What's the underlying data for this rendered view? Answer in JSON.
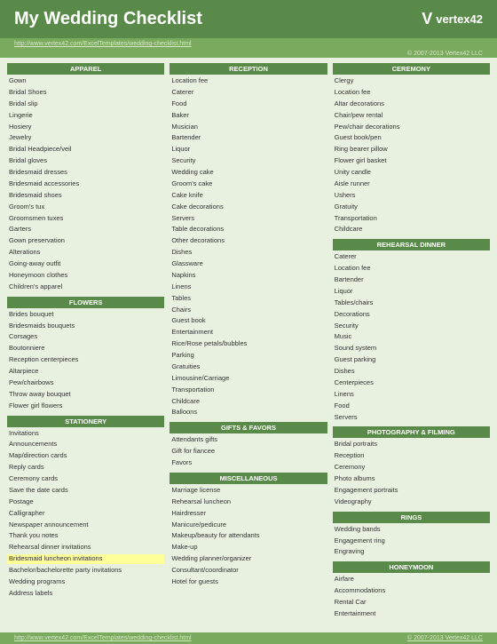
{
  "header": {
    "title": "My Wedding Checklist",
    "logo": "vertex42"
  },
  "urls": {
    "top": "http://www.vertex42.com/ExcelTemplates/wedding-checklist.html",
    "bottom": "http://www.vertex42.com/ExcelTemplates/wedding-checklist.html"
  },
  "copyright": "© 2007-2013 Vertex42 LLC",
  "columns": [
    {
      "sections": [
        {
          "header": "APPAREL",
          "items": [
            "Gown",
            "Bridal Shoes",
            "Bridal slip",
            "Lingerie",
            "Hosiery",
            "Jewelry",
            "Bridal Headpiece/veil",
            "Bridal gloves",
            "Bridesmaid dresses",
            "Bridesmaid accessories",
            "Bridesmaid shoes",
            "Groom's tux",
            "Groomsmen tuxes",
            "Garters",
            "Gown preservation",
            "Alterations",
            "Going-away outfit",
            "Honeymoon clothes",
            "Children's apparel"
          ]
        },
        {
          "header": "FLOWERS",
          "items": [
            "Brides bouquet",
            "Bridesmaids bouquets",
            "Corsages",
            "Boutonniere",
            "Reception centerpieces",
            "Altarpiece",
            "Pew/chairbows",
            "Throw away bouquet",
            "Flower girl flowers"
          ]
        },
        {
          "header": "STATIONERY",
          "items": [
            "Invitations",
            "Announcements",
            "Map/direction cards",
            "Reply cards",
            "Ceremony cards",
            "Save the date cards",
            "Postage",
            "Calligrapher",
            "Newspaper announcement",
            "Thank you notes",
            "Rehearsal dinner invitations",
            "Bridesmaid luncheon invitations",
            "Bachelor/bachelorette party invitations",
            "Wedding programs",
            "Address labels"
          ]
        }
      ]
    },
    {
      "sections": [
        {
          "header": "RECEPTION",
          "items": [
            "Location fee",
            "Caterer",
            "Food",
            "Baker",
            "Musician",
            "Bartender",
            "Liquor",
            "Security",
            "Wedding cake",
            "Groom's cake",
            "Cake knife",
            "Cake decorations",
            "Servers",
            "Table decorations",
            "Other decorations",
            "Dishes",
            "Glassware",
            "Napkins",
            "Linens",
            "Tables",
            "Chairs",
            "Guest book",
            "Entertainment",
            "Rice/Rose petals/bubbles",
            "Parking",
            "Gratuities",
            "Limousine/Carriage",
            "Transportation",
            "Childcare",
            "Balloons"
          ]
        },
        {
          "header": "GIFTS & FAVORS",
          "items": [
            "Attendants gifts",
            "Gift for fiancee",
            "Favors"
          ]
        },
        {
          "header": "MISCELLANEOUS",
          "items": [
            "Marriage license",
            "Rehearsal luncheon",
            "Hairdresser",
            "Manicure/pedicure",
            "Makeup/beauty for attendants",
            "Make-up",
            "Wedding planner/organizer",
            "Consultant/coordinator",
            "Hotel for guests"
          ]
        }
      ]
    },
    {
      "sections": [
        {
          "header": "CEREMONY",
          "items": [
            "Clergy",
            "Location fee",
            "Altar decorations",
            "Chair/pew rental",
            "Pew/chair decorations",
            "Guest book/pen",
            "Ring bearer pillow",
            "Flower girl basket",
            "Unity candle",
            "Aisle runner",
            "Ushers",
            "Gratuity",
            "Transportation",
            "Childcare"
          ]
        },
        {
          "header": "REHEARSAL DINNER",
          "items": [
            "Caterer",
            "Location fee",
            "Bartender",
            "Liquor",
            "Tables/chairs",
            "Decorations",
            "Security",
            "Music",
            "Sound system",
            "Guest parking",
            "Dishes",
            "Centerpieces",
            "Linens",
            "Food",
            "Servers"
          ]
        },
        {
          "header": "PHOTOGRAPHY & FILMING",
          "items": [
            "Bridal portraits",
            "Reception",
            "Ceremony",
            "Photo albums",
            "Engagement portraits",
            "Videography"
          ]
        },
        {
          "header": "RINGS",
          "items": [
            "Wedding bands",
            "Engagement ring",
            "Engraving"
          ]
        },
        {
          "header": "HONEYMOON",
          "items": [
            "Airfare",
            "Accommodations",
            "Rental Car",
            "Entertainment"
          ]
        }
      ]
    }
  ]
}
